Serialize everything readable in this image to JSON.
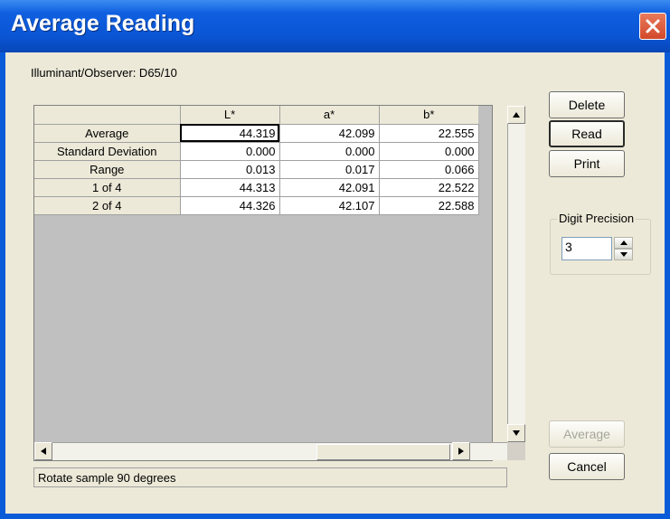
{
  "window": {
    "title": "Average Reading"
  },
  "illuminant_label": "Illuminant/Observer: D65/10",
  "table": {
    "columns": [
      "L*",
      "a*",
      "b*"
    ],
    "rows": [
      {
        "label": "Average",
        "values": [
          "44.319",
          "42.099",
          "22.555"
        ]
      },
      {
        "label": "Standard Deviation",
        "values": [
          "0.000",
          "0.000",
          "0.000"
        ]
      },
      {
        "label": "Range",
        "values": [
          "0.013",
          "0.017",
          "0.066"
        ]
      },
      {
        "label": "1 of 4",
        "values": [
          "44.313",
          "42.091",
          "22.522"
        ]
      },
      {
        "label": "2 of 4",
        "values": [
          "44.326",
          "42.107",
          "22.588"
        ]
      }
    ]
  },
  "buttons": {
    "delete": "Delete",
    "read": "Read",
    "print": "Print",
    "average": "Average",
    "cancel": "Cancel"
  },
  "digit_precision": {
    "label": "Digit Precision",
    "value": "3"
  },
  "status_text": "Rotate sample 90 degrees",
  "colors": {
    "titlebar": "#0a55d4",
    "client": "#ece9d8",
    "close": "#d2482a"
  }
}
